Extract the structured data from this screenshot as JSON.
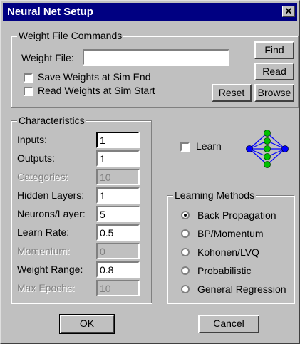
{
  "window": {
    "title": "Neural Net Setup",
    "close_glyph": "✕"
  },
  "weight_file": {
    "legend": "Weight File Commands",
    "label": "Weight File:",
    "value": "",
    "save_label": "Save Weights at Sim End",
    "read_label": "Read Weights at Sim Start",
    "find_label": "Find",
    "read_button_label": "Read",
    "reset_label": "Reset",
    "browse_label": "Browse"
  },
  "characteristics": {
    "legend": "Characteristics",
    "inputs_label": "Inputs:",
    "inputs_value": "1",
    "outputs_label": "Outputs:",
    "outputs_value": "1",
    "categories_label": "Categories:",
    "categories_value": "10",
    "hidden_layers_label": "Hidden Layers:",
    "hidden_layers_value": "1",
    "neurons_label": "Neurons/Layer:",
    "neurons_value": "5",
    "learn_rate_label": "Learn Rate:",
    "learn_rate_value": "0.5",
    "momentum_label": "Momentum:",
    "momentum_value": "0",
    "weight_range_label": "Weight Range:",
    "weight_range_value": "0.8",
    "max_epochs_label": "Max Epochs:",
    "max_epochs_value": "10"
  },
  "learn": {
    "label": "Learn"
  },
  "learning_methods": {
    "legend": "Learning Methods",
    "backprop": "Back Propagation",
    "bp_momentum": "BP/Momentum",
    "kohonen": "Kohonen/LVQ",
    "probabilistic": "Probabilistic",
    "general_regression": "General Regression"
  },
  "buttons": {
    "ok": "OK",
    "cancel": "Cancel"
  },
  "colors": {
    "titlebar": "#000082",
    "node_input_output": "#0000ff",
    "node_hidden": "#00c000"
  },
  "icons": {
    "network_diagram": "neural-network-icon"
  }
}
